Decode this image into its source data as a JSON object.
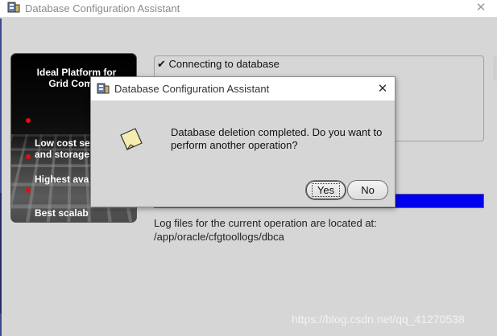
{
  "main_window": {
    "title": "Database Configuration Assistant",
    "close_glyph": "✕",
    "icon": "dbca-app-icon"
  },
  "banner": {
    "title": "Ideal Platform for\nGrid Compu",
    "items": [
      {
        "label": "Low cost se\nand storage"
      },
      {
        "label": "Highest ava"
      },
      {
        "label": "Best scalab"
      }
    ],
    "bullet_color": "#e01010"
  },
  "status": {
    "steps": [
      {
        "check": "✔",
        "label": "Connecting to database"
      }
    ]
  },
  "progress": {
    "percent": 100,
    "fill_color": "#0000ee"
  },
  "log": {
    "line1": "Log files for the current operation are located at:",
    "line2": "/app/oracle/cfgtoollogs/dbca"
  },
  "dialog": {
    "title": "Database Configuration Assistant",
    "close_glyph": "✕",
    "message": "Database deletion completed. Do you want to perform another operation?",
    "icon": "note-icon",
    "buttons": {
      "yes": "Yes",
      "no": "No"
    }
  },
  "watermark": "https://blog.csdn.net/qq_41270538"
}
